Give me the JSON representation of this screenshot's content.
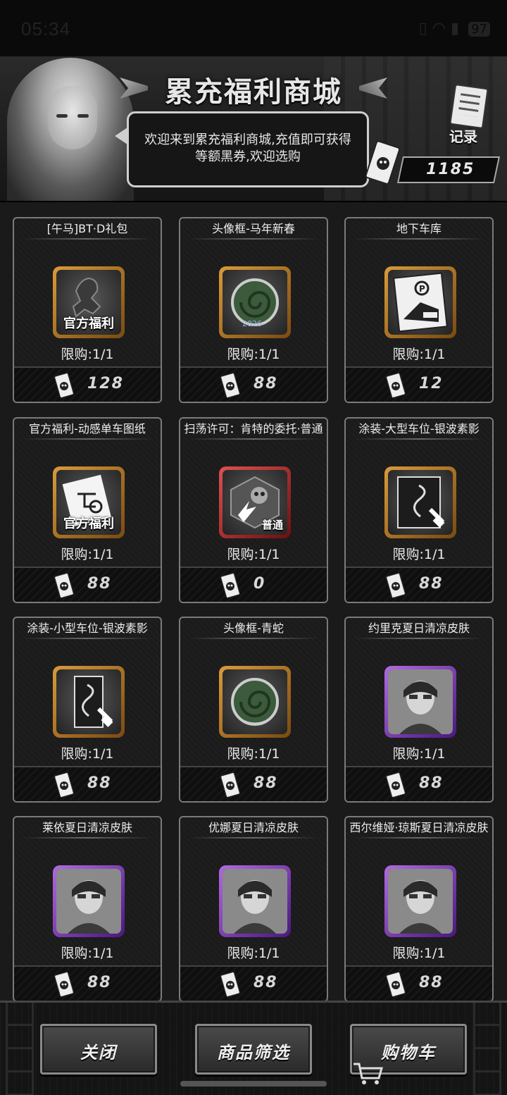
{
  "status": {
    "time": "05:34",
    "battery": "97"
  },
  "header": {
    "title": "累充福利商城",
    "welcome": "欢迎来到累充福利商城,充值即可获得等额黑券,欢迎选购",
    "records_label": "记录",
    "balance": "1185"
  },
  "items": [
    {
      "name": "[午马]BT·D礼包",
      "limit": "限购:1/1",
      "price": "128",
      "frame": "gold",
      "stamp": "官方福利",
      "icon": "scorpion-mech-icon"
    },
    {
      "name": "头像框-马年新春",
      "limit": "限购:1/1",
      "price": "88",
      "frame": "gold",
      "stamp": "",
      "icon": "horse-new-year-frame-icon"
    },
    {
      "name": "地下车库",
      "limit": "限购:1/1",
      "price": "12",
      "frame": "gold",
      "stamp": "",
      "icon": "parking-garage-icon"
    },
    {
      "name": "官方福利-动感单车图纸",
      "limit": "限购:1/1",
      "price": "88",
      "frame": "gold",
      "stamp": "官方福利",
      "icon": "bike-blueprint-icon"
    },
    {
      "name": "扫荡许可：肯特的委托·普通",
      "limit": "限购:1/1",
      "price": "0",
      "frame": "red",
      "stamp": "普通",
      "icon": "sweep-permit-icon"
    },
    {
      "name": "涂装-大型车位-银波素影",
      "limit": "限购:1/1",
      "price": "88",
      "frame": "gold",
      "stamp": "",
      "icon": "large-paint-icon"
    },
    {
      "name": "涂装-小型车位-银波素影",
      "limit": "限购:1/1",
      "price": "88",
      "frame": "gold",
      "stamp": "",
      "icon": "small-paint-icon"
    },
    {
      "name": "头像框-青蛇",
      "limit": "限购:1/1",
      "price": "88",
      "frame": "gold",
      "stamp": "",
      "icon": "snake-frame-icon"
    },
    {
      "name": "约里克夏日清凉皮肤",
      "limit": "限购:1/1",
      "price": "88",
      "frame": "purple",
      "stamp": "",
      "icon": "yorick-skin-icon"
    },
    {
      "name": "莱依夏日清凉皮肤",
      "limit": "限购:1/1",
      "price": "88",
      "frame": "purple",
      "stamp": "",
      "icon": "lei-skin-icon"
    },
    {
      "name": "优娜夏日清凉皮肤",
      "limit": "限购:1/1",
      "price": "88",
      "frame": "purple",
      "stamp": "",
      "icon": "yuna-skin-icon"
    },
    {
      "name": "西尔维娅·琼斯夏日清凉皮肤",
      "limit": "限购:1/1",
      "price": "88",
      "frame": "purple",
      "stamp": "",
      "icon": "sylvia-skin-icon"
    }
  ],
  "footer": {
    "close": "关闭",
    "filter": "商品筛选",
    "cart": "购物车"
  },
  "colors": {
    "gold": "#d99a3a",
    "red": "#e05050",
    "purple": "#b06ae0"
  }
}
